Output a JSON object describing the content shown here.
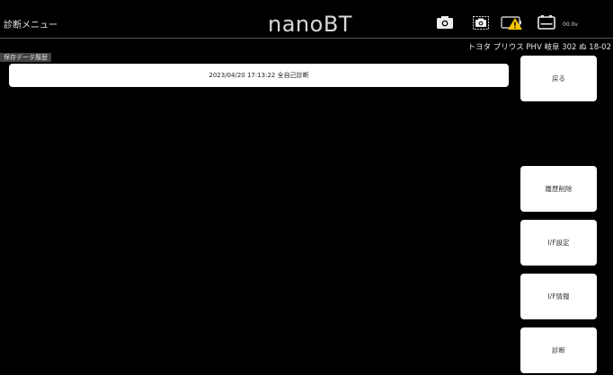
{
  "header": {
    "menu_title": "診断メニュー",
    "logo": "nanoBT",
    "voltage": "00.0v",
    "icons": [
      "camera-icon",
      "screenshot-icon",
      "battery-warning-icon",
      "battery-icon"
    ],
    "colors": {
      "background": "#000000",
      "warning": "#f5c400"
    }
  },
  "vehicle_info": "トヨタ プリウス PHV 岐阜 302 ぬ 18-02",
  "section_label": "保存データ履歴",
  "records": [
    {
      "label": "2023/04/20 17:13:22 全自己診断"
    }
  ],
  "sidebar": {
    "back_label": "戻る",
    "delete_history_label": "履歴削除",
    "if_settings_label": "I/F設定",
    "if_info_label": "I/F情報",
    "diagnosis_label": "診断"
  }
}
